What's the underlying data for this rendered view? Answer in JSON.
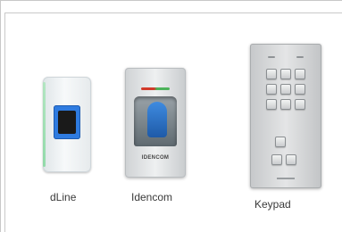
{
  "products": [
    {
      "name": "dLine"
    },
    {
      "name": "Idencom"
    },
    {
      "name": "Keypad"
    }
  ],
  "idencom_brand": "IDENCOM",
  "colors": {
    "sensor_blue": "#2e7be0",
    "led_red": "#d23a2a",
    "led_green": "#4db35b",
    "frame_border": "#c8c8c8"
  }
}
